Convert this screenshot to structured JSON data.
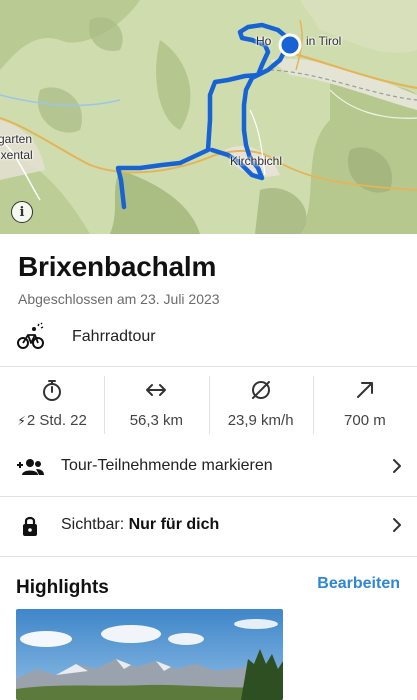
{
  "map": {
    "labels": {
      "town_top": "in Tirol",
      "town_top_partial": "Ho",
      "town_mid": "Kirchbichl",
      "left_top": "garten",
      "left_bottom": "ixental"
    }
  },
  "tour": {
    "title": "Brixenbachalm",
    "completed": "Abgeschlossen am 23. Juli 2023",
    "sport": "Fahrradtour"
  },
  "stats": [
    {
      "icon": "stopwatch-icon",
      "value": "2 Std. 22",
      "prefix_icon": "bolt-icon"
    },
    {
      "icon": "distance-arrows-icon",
      "value": "56,3 km"
    },
    {
      "icon": "average-speed-icon",
      "value": "23,9 km/h"
    },
    {
      "icon": "elevation-arrow-icon",
      "value": "700 m"
    }
  ],
  "rows": {
    "participants": "Tour-Teilnehmende markieren",
    "visibility_label": "Sichtbar:",
    "visibility_value": "Nur für dich"
  },
  "highlights": {
    "title": "Highlights",
    "edit": "Bearbeiten"
  },
  "colors": {
    "route": "#1763d4",
    "accent": "#2e86d4"
  }
}
